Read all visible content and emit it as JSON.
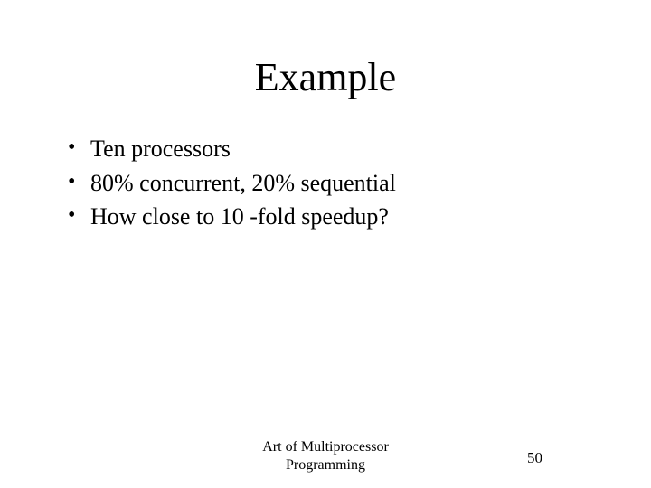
{
  "slide": {
    "title": "Example",
    "bullets": [
      "Ten processors",
      "80% concurrent, 20% sequential",
      "How close to 10 -fold speedup?"
    ],
    "footer_line1": "Art of Multiprocessor",
    "footer_line2": "Programming",
    "page_number": "50"
  }
}
